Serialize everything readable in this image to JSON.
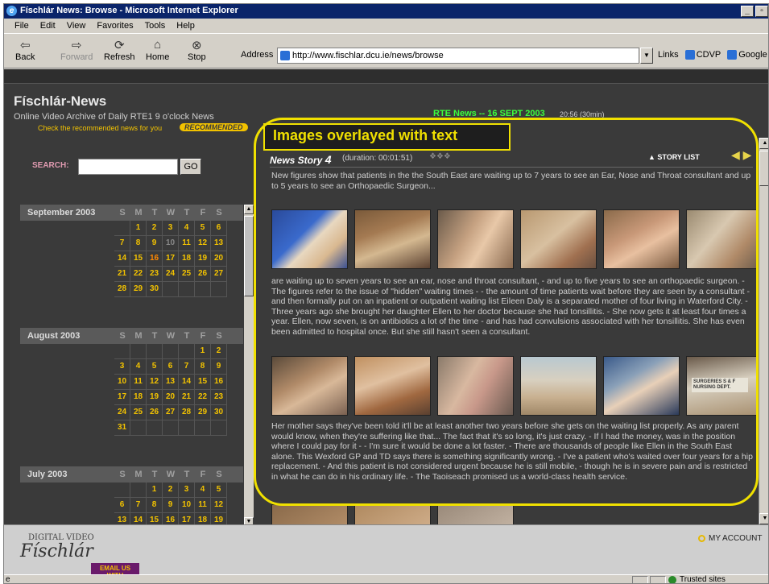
{
  "window": {
    "title": "Físchlár News: Browse - Microsoft Internet Explorer"
  },
  "menu": [
    "File",
    "Edit",
    "View",
    "Favorites",
    "Tools",
    "Help"
  ],
  "toolbar": {
    "back": "Back",
    "forward": "Forward",
    "refresh": "Refresh",
    "home": "Home",
    "stop": "Stop"
  },
  "address": {
    "label": "Address",
    "url": "http://www.fischlar.dcu.ie/news/browse"
  },
  "links": {
    "label": "Links",
    "items": [
      "CDVP",
      "Google"
    ]
  },
  "site": {
    "name": "Físchlár-News",
    "subtitle": "Online Video Archive of Daily RTE1 9 o'clock News",
    "recommend_text": "Check the recommended news for you",
    "recommend_badge": "RECOMMENDED"
  },
  "search": {
    "label": "SEARCH:",
    "value": "",
    "button": "GO"
  },
  "calendars": [
    {
      "title": "September 2003",
      "days": [
        "",
        "1",
        "2",
        "3",
        "4",
        "5",
        "6",
        "7",
        "8",
        "9",
        "10",
        "11",
        "12",
        "13",
        "14",
        "15",
        "16",
        "17",
        "18",
        "19",
        "20",
        "21",
        "22",
        "23",
        "24",
        "25",
        "26",
        "27",
        "28",
        "29",
        "30",
        "",
        "",
        "",
        ""
      ]
    },
    {
      "title": "August 2003",
      "days": [
        "",
        "",
        "",
        "",
        "",
        "1",
        "2",
        "3",
        "4",
        "5",
        "6",
        "7",
        "8",
        "9",
        "10",
        "11",
        "12",
        "13",
        "14",
        "15",
        "16",
        "17",
        "18",
        "19",
        "20",
        "21",
        "22",
        "23",
        "24",
        "25",
        "26",
        "27",
        "28",
        "29",
        "30",
        "31",
        "",
        "",
        "",
        "",
        "",
        ""
      ]
    },
    {
      "title": "July 2003",
      "days": [
        "",
        "",
        "1",
        "2",
        "3",
        "4",
        "5",
        "6",
        "7",
        "8",
        "9",
        "10",
        "11",
        "12",
        "13",
        "14",
        "15",
        "16",
        "17",
        "18",
        "19"
      ]
    }
  ],
  "dow": [
    "S",
    "M",
    "T",
    "W",
    "T",
    "F",
    "S"
  ],
  "episode": {
    "title": "RTE News -- 16 SEPT 2003",
    "time": "20:56",
    "duration": "(30min)"
  },
  "callout": "Images overlayed with text",
  "story": {
    "label": "News Story",
    "number": "4",
    "duration": "(duration: 00:01:51)",
    "story_list": "▲ STORY LIST",
    "summary": "New figures show that patients in the the South East are waiting up to 7 years to see an Ear, Nose and Throat consultant and up to 5 years to see an Orthopaedic Surgeon...",
    "para1": "are waiting up to seven years to see an ear, nose and throat consultant, - and up to five years to see an orthopaedic surgeon. - The figures refer to the issue of \"hidden\" waiting times - - the amount of time patients wait before they are seen by a consultant - and then formally put on an inpatient or outpatient waiting list Eileen Daly is a separated mother of four living in Waterford City. - Three years ago she brought her daughter Ellen to her doctor because she had tonsillitis. - She now gets it at least four times a year. Ellen, now seven, is on antibiotics a lot of the time - and has had convulsions associated with her tonsillitis. She has even been admitted to hospital once. But she still hasn't seen a consultant.",
    "para2": "Her mother says they've been told it'll be at least another two years before she gets on the waiting list properly. As any parent would know, when they're suffering like that... The fact that it's so long, it's just crazy. - If I had the money, was in the position where I could pay for it - - I'm sure it would be done a lot faster. - There are thousands of people like Ellen in the South East alone. This Wexford GP and TD says there is something significantly wrong. - I've a patient who's waited over four years for a hip replacement. - And this patient is not considered urgent because he is still mobile, - though he is in severe pain and is restricted in what he can do in his ordinary life. - The Taoiseach promised us a world-class health service.",
    "frame_label": "SURGERIES S & F NURSING DEPT."
  },
  "footer": {
    "logo_top": "DIGITAL VIDEO",
    "logo": "Físchlár",
    "email": "EMAIL US WITH COMMENTS",
    "account": "MY ACCOUNT"
  },
  "status": {
    "zone": "Trusted sites"
  }
}
